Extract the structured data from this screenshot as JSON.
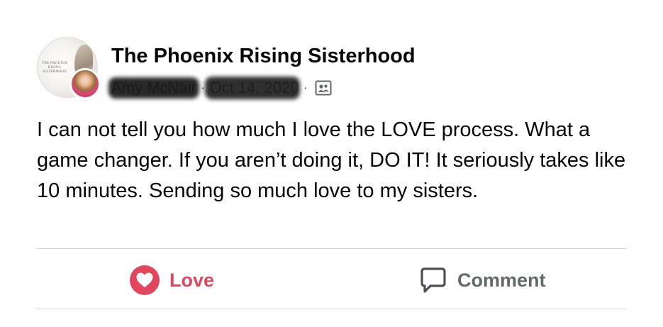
{
  "post": {
    "group_name": "The Phoenix Rising Sisterhood",
    "author": "Amy McNair",
    "separator": "·",
    "date": "Oct 14, 2020",
    "group_logo_text": "THE PHOENIX RISING SISTERHOOD",
    "body": "I can not tell you how much I love the LOVE process. What a game changer.  If you aren’t doing it,  DO IT!  It seriously takes like 10 minutes.  Sending so much love to my sisters."
  },
  "actions": {
    "love_label": "Love",
    "comment_label": "Comment"
  },
  "icons": {
    "group_avatar": "group-logo",
    "member_avatar": "profile-photo",
    "privacy": "group-members-icon",
    "love": "heart-icon",
    "comment": "speech-bubble-icon"
  },
  "colors": {
    "love_accent": "#e2465c",
    "secondary_text": "#65676b",
    "primary_text": "#050505"
  }
}
